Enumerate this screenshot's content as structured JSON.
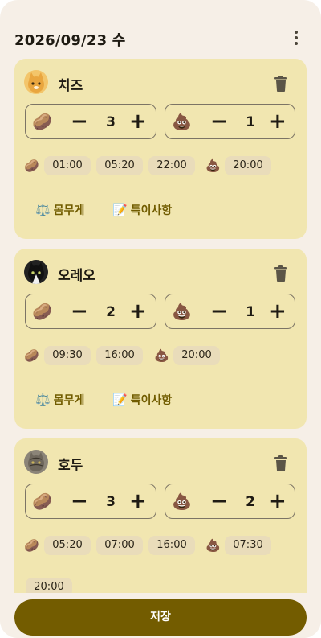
{
  "header": {
    "date": "2026/09/23 수",
    "more_icon": "more-vert-icon"
  },
  "icons": {
    "feed": "🥔",
    "poop": "💩",
    "weight": "⚖️",
    "notes": "📝",
    "delete": "trash-icon"
  },
  "colors": {
    "card": "#f1e6b0",
    "chip": "#e9dcba",
    "accent": "#735c00",
    "background": "#f6efe7"
  },
  "cats": [
    {
      "name": "치즈",
      "feed_count": "3",
      "poop_count": "1",
      "feed_times": [
        "01:00",
        "05:20",
        "22:00"
      ],
      "poop_times": [
        "20:00"
      ],
      "weight_label": "몸무게",
      "notes_label": "특이사항"
    },
    {
      "name": "오레오",
      "feed_count": "2",
      "poop_count": "1",
      "feed_times": [
        "09:30",
        "16:00"
      ],
      "poop_times": [
        "20:00"
      ],
      "weight_label": "몸무게",
      "notes_label": "특이사항"
    },
    {
      "name": "호두",
      "feed_count": "3",
      "poop_count": "2",
      "feed_times": [
        "05:20",
        "07:00",
        "16:00"
      ],
      "poop_times": [
        "07:30",
        "20:00"
      ]
    }
  ],
  "stepper": {
    "minus": "−",
    "plus": "+"
  },
  "save_label": "저장"
}
